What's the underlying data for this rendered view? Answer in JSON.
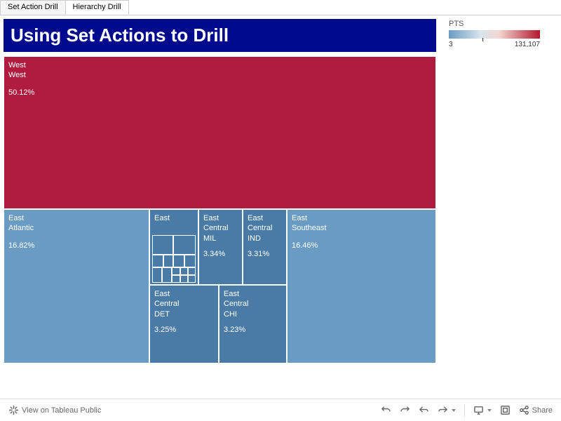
{
  "tabs": {
    "t0": "Set Action Drill",
    "t1": "Hierarchy Drill"
  },
  "title": "Using Set Actions to Drill",
  "legend": {
    "title": "PTS",
    "min": "3",
    "max": "131,107"
  },
  "cells": {
    "west": {
      "l1": "West",
      "l2": "West",
      "pct": "50.12%"
    },
    "atlantic": {
      "l1": "East",
      "l2": "Atlantic",
      "pct": "16.82%"
    },
    "southeast": {
      "l1": "East",
      "l2": "Southeast",
      "pct": "16.46%"
    },
    "east": {
      "l1": "East"
    },
    "mil": {
      "l1": "East",
      "l2": "Central",
      "l3": "MIL",
      "pct": "3.34%"
    },
    "ind": {
      "l1": "East",
      "l2": "Central",
      "l3": "IND",
      "pct": "3.31%"
    },
    "det": {
      "l1": "East",
      "l2": "Central",
      "l3": "DET",
      "pct": "3.25%"
    },
    "chi": {
      "l1": "East",
      "l2": "Central",
      "l3": "CHI",
      "pct": "3.23%"
    }
  },
  "toolbar": {
    "view": "View on Tableau Public",
    "share": "Share"
  },
  "chart_data": {
    "type": "treemap",
    "title": "Using Set Actions to Drill",
    "color_metric": "PTS",
    "color_range": [
      3,
      131107
    ],
    "nodes": [
      {
        "path": [
          "West",
          "West"
        ],
        "pct": 50.12,
        "color": "#b01c3f"
      },
      {
        "path": [
          "East",
          "Atlantic"
        ],
        "pct": 16.82,
        "color": "#6a9bc3"
      },
      {
        "path": [
          "East",
          "Southeast"
        ],
        "pct": 16.46,
        "color": "#6a9bc3"
      },
      {
        "path": [
          "East",
          "Central",
          "MIL"
        ],
        "pct": 3.34,
        "color": "#4a7ba6"
      },
      {
        "path": [
          "East",
          "Central",
          "IND"
        ],
        "pct": 3.31,
        "color": "#4a7ba6"
      },
      {
        "path": [
          "East",
          "Central",
          "DET"
        ],
        "pct": 3.25,
        "color": "#4a7ba6"
      },
      {
        "path": [
          "East",
          "Central",
          "CHI"
        ],
        "pct": 3.23,
        "color": "#4a7ba6"
      },
      {
        "path": [
          "East"
        ],
        "pct": 3.47,
        "color": "#4a7ba6",
        "note": "small remainder tiles"
      }
    ]
  }
}
